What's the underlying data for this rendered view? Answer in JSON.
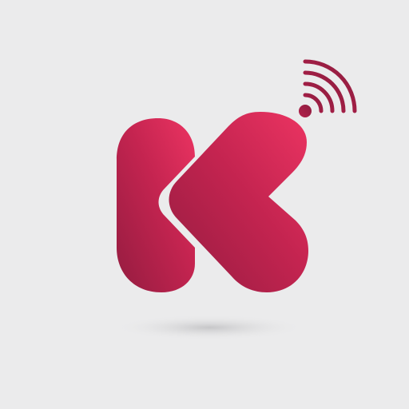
{
  "logo": {
    "icon": "k-heart-logo-icon",
    "signal_icon": "wireless-signal-icon",
    "colors": {
      "background": "#ebebec",
      "gradient_light": "#e8325f",
      "gradient_dark": "#9c1f44",
      "shadow": "#c9c9cb"
    }
  }
}
